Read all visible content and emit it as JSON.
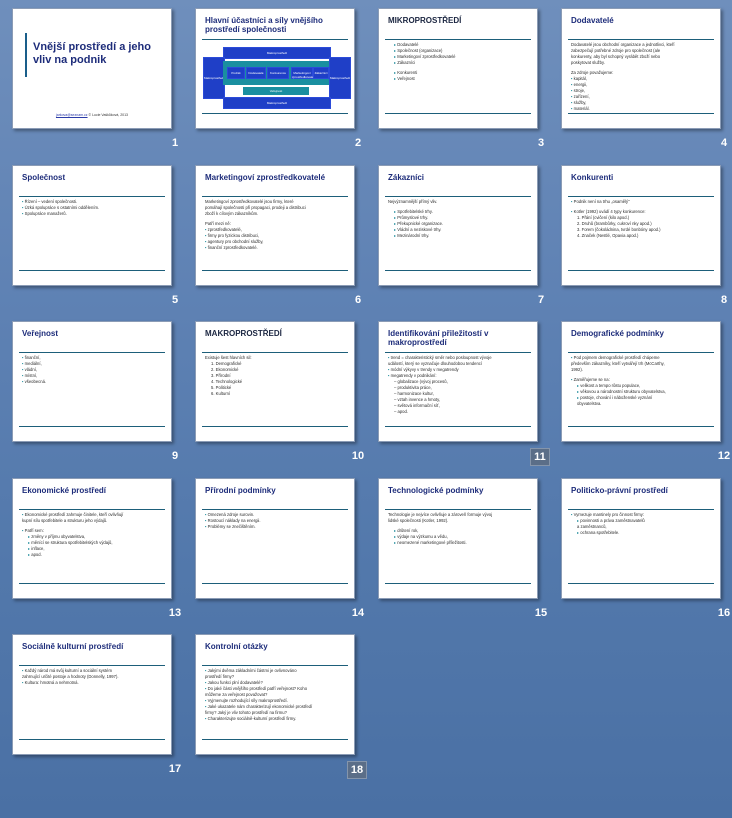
{
  "slides": [
    {
      "num": "1",
      "title": "Vnější prostředí a jeho vliv na podnik",
      "footer_link": "jarkova@seznam.cz",
      "footer_text": " © Lucie Vaškůková, 2013"
    },
    {
      "num": "2",
      "title": "Hlavní účastníci a síly vnějšího prostředí společnosti",
      "diagram": {
        "top": "Makroprostředí",
        "bottom": "Makroprostředí",
        "left": "Makroprostředí",
        "right": "Makroprostředí",
        "items": [
          "Podnik",
          "Dodavatelé",
          "Konkurence",
          "Marketingoví zprostředkovatelé",
          "Zákazníci"
        ],
        "sub": "Veřejnost"
      }
    },
    {
      "num": "3",
      "title": "MIKROPROSTŘEDÍ",
      "lines": [
        {
          "t": "Dodavatelé",
          "k": "b2"
        },
        {
          "t": "Společnost (organizace)",
          "k": "b2"
        },
        {
          "t": "Marketingoví zprostředkovatelé",
          "k": "b2"
        },
        {
          "t": "Zákazníci",
          "k": "b2"
        },
        {
          "t": "",
          "k": "p"
        },
        {
          "t": "Konkurenti",
          "k": "b2"
        },
        {
          "t": "Veřejnost",
          "k": "b2"
        }
      ]
    },
    {
      "num": "4",
      "title": "Dodavatelé",
      "lines": [
        {
          "t": "Dodavatelé jsou obchodní organizace a jednotlivci, kteří",
          "k": "p"
        },
        {
          "t": "zabezpečují potřebné zdroje pro společnost (ale",
          "k": "p"
        },
        {
          "t": "konkurenty, aby byl schopný vyrábět zboží nebo",
          "k": "p"
        },
        {
          "t": "poskytovat služby.",
          "k": "p"
        },
        {
          "t": "",
          "k": "p"
        },
        {
          "t": "Za zdroje považujeme:",
          "k": "p"
        },
        {
          "t": "kapitál,",
          "k": "b1"
        },
        {
          "t": "energii,",
          "k": "b1"
        },
        {
          "t": "stroje,",
          "k": "b1"
        },
        {
          "t": "zařízení,",
          "k": "b1"
        },
        {
          "t": "služby,",
          "k": "b1"
        },
        {
          "t": "materiál.",
          "k": "b1"
        }
      ]
    },
    {
      "num": "5",
      "title": "Společnost",
      "lines": [
        {
          "t": "Řízení – vedení společnosti.",
          "k": "b1"
        },
        {
          "t": "Úzká spolupráce s ostatními oddělením.",
          "k": "b1"
        },
        {
          "t": "Spolupráce manažerů.",
          "k": "b1"
        }
      ]
    },
    {
      "num": "6",
      "title": "Marketingoví zprostředkovatelé",
      "lines": [
        {
          "t": "Marketingoví zprostředkovatelé jsou firmy, které",
          "k": "p"
        },
        {
          "t": "pomáhají společnosti při propagaci, prodeji a distribuci",
          "k": "p"
        },
        {
          "t": "zboží k cílovým zákazníkům.",
          "k": "p"
        },
        {
          "t": "",
          "k": "p"
        },
        {
          "t": "Patří mezi ně:",
          "k": "p"
        },
        {
          "t": "zprostředkovatelé,",
          "k": "b1"
        },
        {
          "t": "firmy pro fyzickou distribuci,",
          "k": "b1"
        },
        {
          "t": "agentury pro obchodní služby,",
          "k": "b1"
        },
        {
          "t": "finanční zprostředkovatelé.",
          "k": "b1"
        }
      ]
    },
    {
      "num": "7",
      "title": "Zákazníci",
      "lines": [
        {
          "t": "Nejvýznamnější přímý vliv.",
          "k": "p"
        },
        {
          "t": "",
          "k": "p"
        },
        {
          "t": "Spotřebitelské trhy.",
          "k": "b2"
        },
        {
          "t": "Průmyslové trhy.",
          "k": "b2"
        },
        {
          "t": "Překupnické organizace.",
          "k": "b2"
        },
        {
          "t": "Vládní a neziskové trhy.",
          "k": "b2"
        },
        {
          "t": "Mezinárodní trhy.",
          "k": "b2"
        }
      ]
    },
    {
      "num": "8",
      "title": "Konkurenti",
      "lines": [
        {
          "t": "Podnik není na trhu „osamělý\"",
          "k": "b1"
        },
        {
          "t": "",
          "k": "p"
        },
        {
          "t": "Kotler (1992) uvádí 4 typy konkurence:",
          "k": "b1"
        },
        {
          "t": "1.  Přání (cvičení (kilo apod.)",
          "k": "nl"
        },
        {
          "t": "2.  Druhů (brambůrky, cukroví nky apod.)",
          "k": "nl"
        },
        {
          "t": "3.  Forem (čokoládnina, tvrdé bonbóny apod.)",
          "k": "nl"
        },
        {
          "t": "4.  Značek (Nestlé, Opavia apod.)",
          "k": "nl"
        }
      ]
    },
    {
      "num": "9",
      "title": "Veřejnost",
      "lines": [
        {
          "t": "finanční,",
          "k": "b1"
        },
        {
          "t": "mediální,",
          "k": "b1"
        },
        {
          "t": "vládní,",
          "k": "b1"
        },
        {
          "t": "místní,",
          "k": "b1"
        },
        {
          "t": "všeobecná.",
          "k": "b1"
        }
      ]
    },
    {
      "num": "10",
      "title": "MAKROPROSTŘEDÍ",
      "lines": [
        {
          "t": "Existuje šest hlavních sil:",
          "k": "p"
        },
        {
          "t": "1.  Demografické",
          "k": "nl"
        },
        {
          "t": "2.  Ekonomické",
          "k": "nl"
        },
        {
          "t": "3.  Přírodní",
          "k": "nl"
        },
        {
          "t": "4.  Technologické",
          "k": "nl"
        },
        {
          "t": "5.  Politické",
          "k": "nl"
        },
        {
          "t": "6.  Kulturní",
          "k": "nl"
        }
      ]
    },
    {
      "num": "11",
      "title": "Identifikování přiležitostí v makroprostředí",
      "lines": [
        {
          "t": "trend = charakteristický směr nebo posloupnost vývoje",
          "k": "b1"
        },
        {
          "t": "událostí, který se vyznačuje dlouhodobou tendencí",
          "k": "p"
        },
        {
          "t": "módní výkyvy v trendy v megatrendy",
          "k": "b1"
        },
        {
          "t": "megatrendy v podnikání:",
          "k": "b1"
        },
        {
          "t": "– globalizace (vývoj procesů,",
          "k": "nl"
        },
        {
          "t": "– produktivita práce,",
          "k": "nl"
        },
        {
          "t": "– harmonizace kultur,",
          "k": "nl"
        },
        {
          "t": "– vztah invence a hmoty,",
          "k": "nl"
        },
        {
          "t": "– světová informační síť,",
          "k": "nl"
        },
        {
          "t": "– apod.",
          "k": "nl"
        }
      ]
    },
    {
      "num": "12",
      "title": "Demografické podmínky",
      "lines": [
        {
          "t": "Pod pojmem demografické prostředí chápeme",
          "k": "b1"
        },
        {
          "t": "především zákazníky, kteří vytvářejí trh (McCarthy,",
          "k": "p"
        },
        {
          "t": "1992).",
          "k": "p"
        },
        {
          "t": "",
          "k": "p"
        },
        {
          "t": "Zaměřujeme se na:",
          "k": "b1"
        },
        {
          "t": "velikost a tempo růstu populace,",
          "k": "b2"
        },
        {
          "t": "věkovou a národnostní strukturu obyvatelstva,",
          "k": "b2"
        },
        {
          "t": "postoje, chování i náboženské vyznání",
          "k": "b2"
        },
        {
          "t": "obyvatelstva.",
          "k": "nl"
        }
      ]
    },
    {
      "num": "13",
      "title": "Ekonomické prostředí",
      "lines": [
        {
          "t": "Ekonomické prostředí zahrnuje činitele, kteří ovlivňují",
          "k": "b1"
        },
        {
          "t": "kupní sílu spotřebitele a strukturu jeho výdajů.",
          "k": "p"
        },
        {
          "t": "",
          "k": "p"
        },
        {
          "t": "Patří sem:",
          "k": "b1"
        },
        {
          "t": "změny v příjmu obyvatelstva,",
          "k": "b2"
        },
        {
          "t": "měnící se struktura spotřebitelských výdajů,",
          "k": "b2"
        },
        {
          "t": "inflace,",
          "k": "b2"
        },
        {
          "t": "apod.",
          "k": "b2"
        }
      ]
    },
    {
      "num": "14",
      "title": "Přírodní podmínky",
      "lines": [
        {
          "t": "Omezená zdroje surovin.",
          "k": "b1"
        },
        {
          "t": "Rostoucí náklady na energii.",
          "k": "b1"
        },
        {
          "t": "Problémy se znečištěním.",
          "k": "b1"
        }
      ]
    },
    {
      "num": "15",
      "title": "Technologické podmínky",
      "lines": [
        {
          "t": "Technologie je nejvíce ovlivňuje a zároveň formuje vývoj",
          "k": "p"
        },
        {
          "t": "lidské společnosti (Kotler, 1992).",
          "k": "p"
        },
        {
          "t": "",
          "k": "p"
        },
        {
          "t": "drůtení rok,",
          "k": "b2"
        },
        {
          "t": "výdaje na výzkumu a vědu,",
          "k": "b2"
        },
        {
          "t": "neomezené marketingové příležitosti.",
          "k": "b2"
        }
      ]
    },
    {
      "num": "16",
      "title": "Politicko-právní prostředí",
      "lines": [
        {
          "t": "Vymezuje mantinely pro činnost firmy:",
          "k": "b1"
        },
        {
          "t": "povinnosti a práva zaměstnavatelů",
          "k": "b2"
        },
        {
          "t": "a zaměstnanců,",
          "k": "nl"
        },
        {
          "t": "ochrana spotřebitele.",
          "k": "b2"
        }
      ]
    },
    {
      "num": "17",
      "title": "Sociálně kulturní prostředí",
      "lines": [
        {
          "t": "Každý národ má svůj kulturní a sociální systém",
          "k": "b1"
        },
        {
          "t": "zahrnující určité postoje a hodnoty (Donnelly, 1997).",
          "k": "p"
        },
        {
          "t": "Kultura: hmotná a nehmotná.",
          "k": "b1"
        }
      ]
    },
    {
      "num": "18",
      "title": "Kontrolní otázky",
      "lines": [
        {
          "t": "Jakými dvěma základními částmi je ovlivnováno",
          "k": "b1"
        },
        {
          "t": "prostředí firmy?",
          "k": "p"
        },
        {
          "t": "Jakou funkci plní dodavatelé?",
          "k": "b1"
        },
        {
          "t": "Do jaké části vnějšího prostředí patří veřejnost? Koho",
          "k": "b1"
        },
        {
          "t": "můžeme za veřejnost považovat?",
          "k": "p"
        },
        {
          "t": "Vyjmenujte rozhodující síly makroprostředí.",
          "k": "b1"
        },
        {
          "t": "Jaké ukazatele nám charakterizují ekonomické prostředí",
          "k": "b1"
        },
        {
          "t": "firmy? Jaký je vliv tohoto prostředí na firmu?",
          "k": "p"
        },
        {
          "t": "Charakterizujte sociálně-kulturní prostředí firmy.",
          "k": "b1"
        }
      ]
    }
  ],
  "selected": [
    "11",
    "18"
  ],
  "colors": {
    "background": "#5f82b4",
    "title": "#1d2c7a",
    "rule": "#1d5f7a",
    "bullet": "#1a8a9a"
  }
}
